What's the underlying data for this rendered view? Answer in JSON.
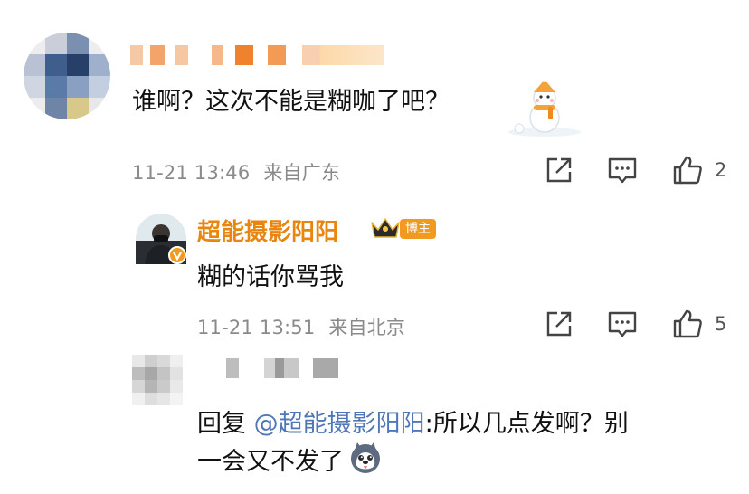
{
  "comment1": {
    "text": "谁啊？这次不能是糊咖了吧？",
    "time": "11-21 13:46",
    "location": "来自广东",
    "like_count": "2"
  },
  "reply1": {
    "username": "超能摄影阳阳",
    "badge": "博主",
    "text": "糊的话你骂我",
    "time": "11-21 13:51",
    "location": "来自北京",
    "like_count": "5"
  },
  "reply2": {
    "prefix": "回复 ",
    "mention": "@超能摄影阳阳",
    "line1_rest": ":所以几点发啊？别",
    "line2": "一会又不发了"
  },
  "icons": {
    "share": "share-icon",
    "comment": "comment-icon",
    "like": "thumbs-up-icon",
    "crown": "crown-icon",
    "verified": "verified-v-icon",
    "snowman": "snowman-sticker",
    "husky": "husky-emoji"
  },
  "colors": {
    "username": "#e9860f",
    "mention": "#4f77b8",
    "meta": "#8a8a8a",
    "badge": "#f29a1f"
  }
}
